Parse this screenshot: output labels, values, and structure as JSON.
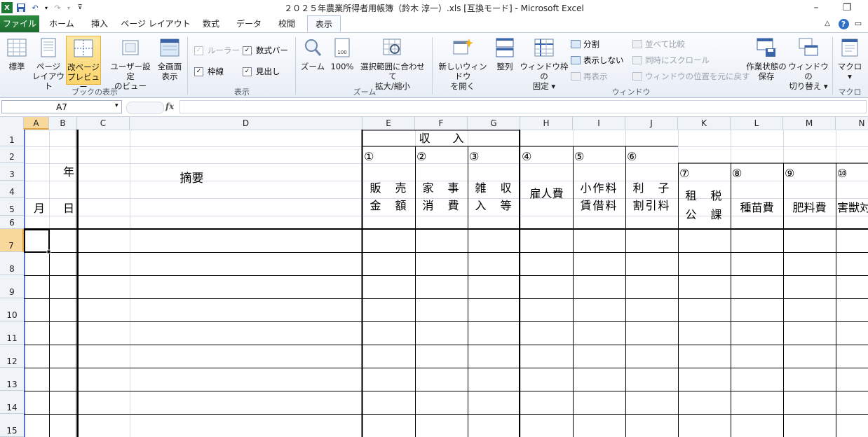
{
  "window": {
    "title": "２０２５年農業所得者用帳簿（鈴木 淳一）.xls  [互換モード] - Microsoft Excel",
    "minimize": "–",
    "restore": "❐"
  },
  "tabs": {
    "file": "ファイル",
    "home": "ホーム",
    "insert": "挿入",
    "layout": "ページ レイアウト",
    "formulas": "数式",
    "data": "データ",
    "review": "校閲",
    "view": "表示"
  },
  "ribbon": {
    "normal": "標準",
    "page_layout": [
      "ページ",
      "レイアウト"
    ],
    "page_break": [
      "改ページ",
      "プレビュー"
    ],
    "custom_views": [
      "ユーザー設定",
      "のビュー"
    ],
    "full_screen": [
      "全画面",
      "表示"
    ],
    "group_workbook_views": "ブックの表示",
    "ruler": "ルーラー",
    "formula_bar": "数式バー",
    "gridlines": "枠線",
    "headings": "見出し",
    "group_show": "表示",
    "zoom": "ズーム",
    "zoom100": "100%",
    "zoom_selection": [
      "選択範囲に合わせて",
      "拡大/縮小"
    ],
    "group_zoom": "ズーム",
    "new_window": [
      "新しいウィンドウ",
      "を開く"
    ],
    "arrange": "整列",
    "freeze": [
      "ウィンドウ枠の",
      "固定 ▾"
    ],
    "split": "分割",
    "hide": "表示しない",
    "unhide": "再表示",
    "side_by_side": "並べて比較",
    "sync_scroll": "同時にスクロール",
    "reset_position": "ウィンドウの位置を元に戻す",
    "save_workspace": [
      "作業状態の",
      "保存"
    ],
    "switch_windows": [
      "ウィンドウの",
      "切り替え ▾"
    ],
    "group_window": "ウィンドウ",
    "macros": [
      "マクロ",
      "▾"
    ],
    "group_macros": "マクロ"
  },
  "formula_bar": {
    "name_box": "A7",
    "fx": "fx",
    "value": ""
  },
  "columns": [
    "A",
    "B",
    "C",
    "D",
    "E",
    "F",
    "G",
    "H",
    "I",
    "J",
    "K",
    "L",
    "M",
    "N"
  ],
  "selected_column": "A",
  "rows": [
    "1",
    "2",
    "3",
    "4",
    "5",
    "6",
    "7",
    "8",
    "9",
    "10",
    "11",
    "12",
    "13",
    "14",
    "15"
  ],
  "selected_row": "7",
  "sheet": {
    "year": "年",
    "month": "月",
    "day": "日",
    "summary": "摘要",
    "income_header": "収　　入",
    "col1_num": "①",
    "col1_label": [
      "販　売",
      "金　額"
    ],
    "col2_num": "②",
    "col2_label": [
      "家　事",
      "消　費"
    ],
    "col3_num": "③",
    "col3_label": [
      "雑　収",
      "入　等"
    ],
    "col4_num": "④",
    "col4_label": "雇人費",
    "col5_num": "⑤",
    "col5_label": [
      "小作料",
      "賃借料"
    ],
    "col6_num": "⑥",
    "col6_label": [
      "利　子",
      "割引料"
    ],
    "col7_num": "⑦",
    "col7_label": [
      "租　税",
      "公　課"
    ],
    "col8_num": "⑧",
    "col8_label": "種苗費",
    "col9_num": "⑨",
    "col9_label": "肥料費",
    "col10_num": "⑩",
    "col10_label": "害獣対"
  },
  "colors": {
    "file_tab": "#1e7b34",
    "selection_header": "#f9d99b",
    "grid_line": "#d4dbe4"
  }
}
